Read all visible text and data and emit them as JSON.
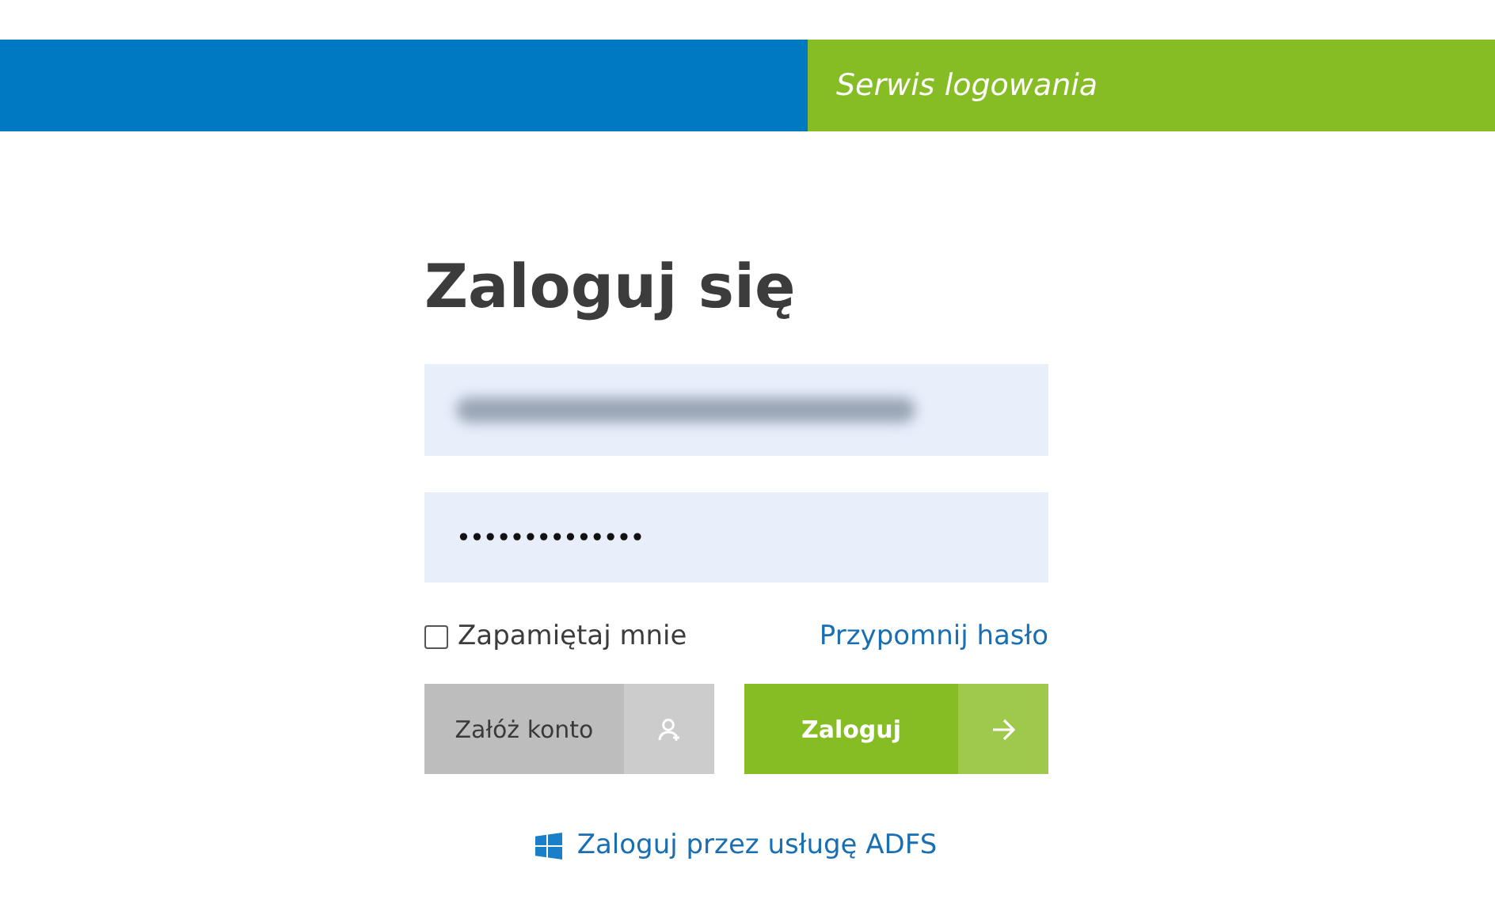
{
  "header": {
    "title": "Serwis logowania"
  },
  "heading": "Zaloguj się",
  "email_field": {
    "kind": "redacted"
  },
  "password_field": {
    "value": "••••••••••••••"
  },
  "remember_me": {
    "label": "Zapamiętaj mnie",
    "checked": false
  },
  "forgot_link": "Przypomnij hasło",
  "buttons": [
    {
      "label": "Załóż konto",
      "kind": "secondary"
    },
    {
      "label": "Zaloguj",
      "kind": "primary"
    }
  ],
  "adfs_link": "Zaloguj przez usługę ADFS"
}
